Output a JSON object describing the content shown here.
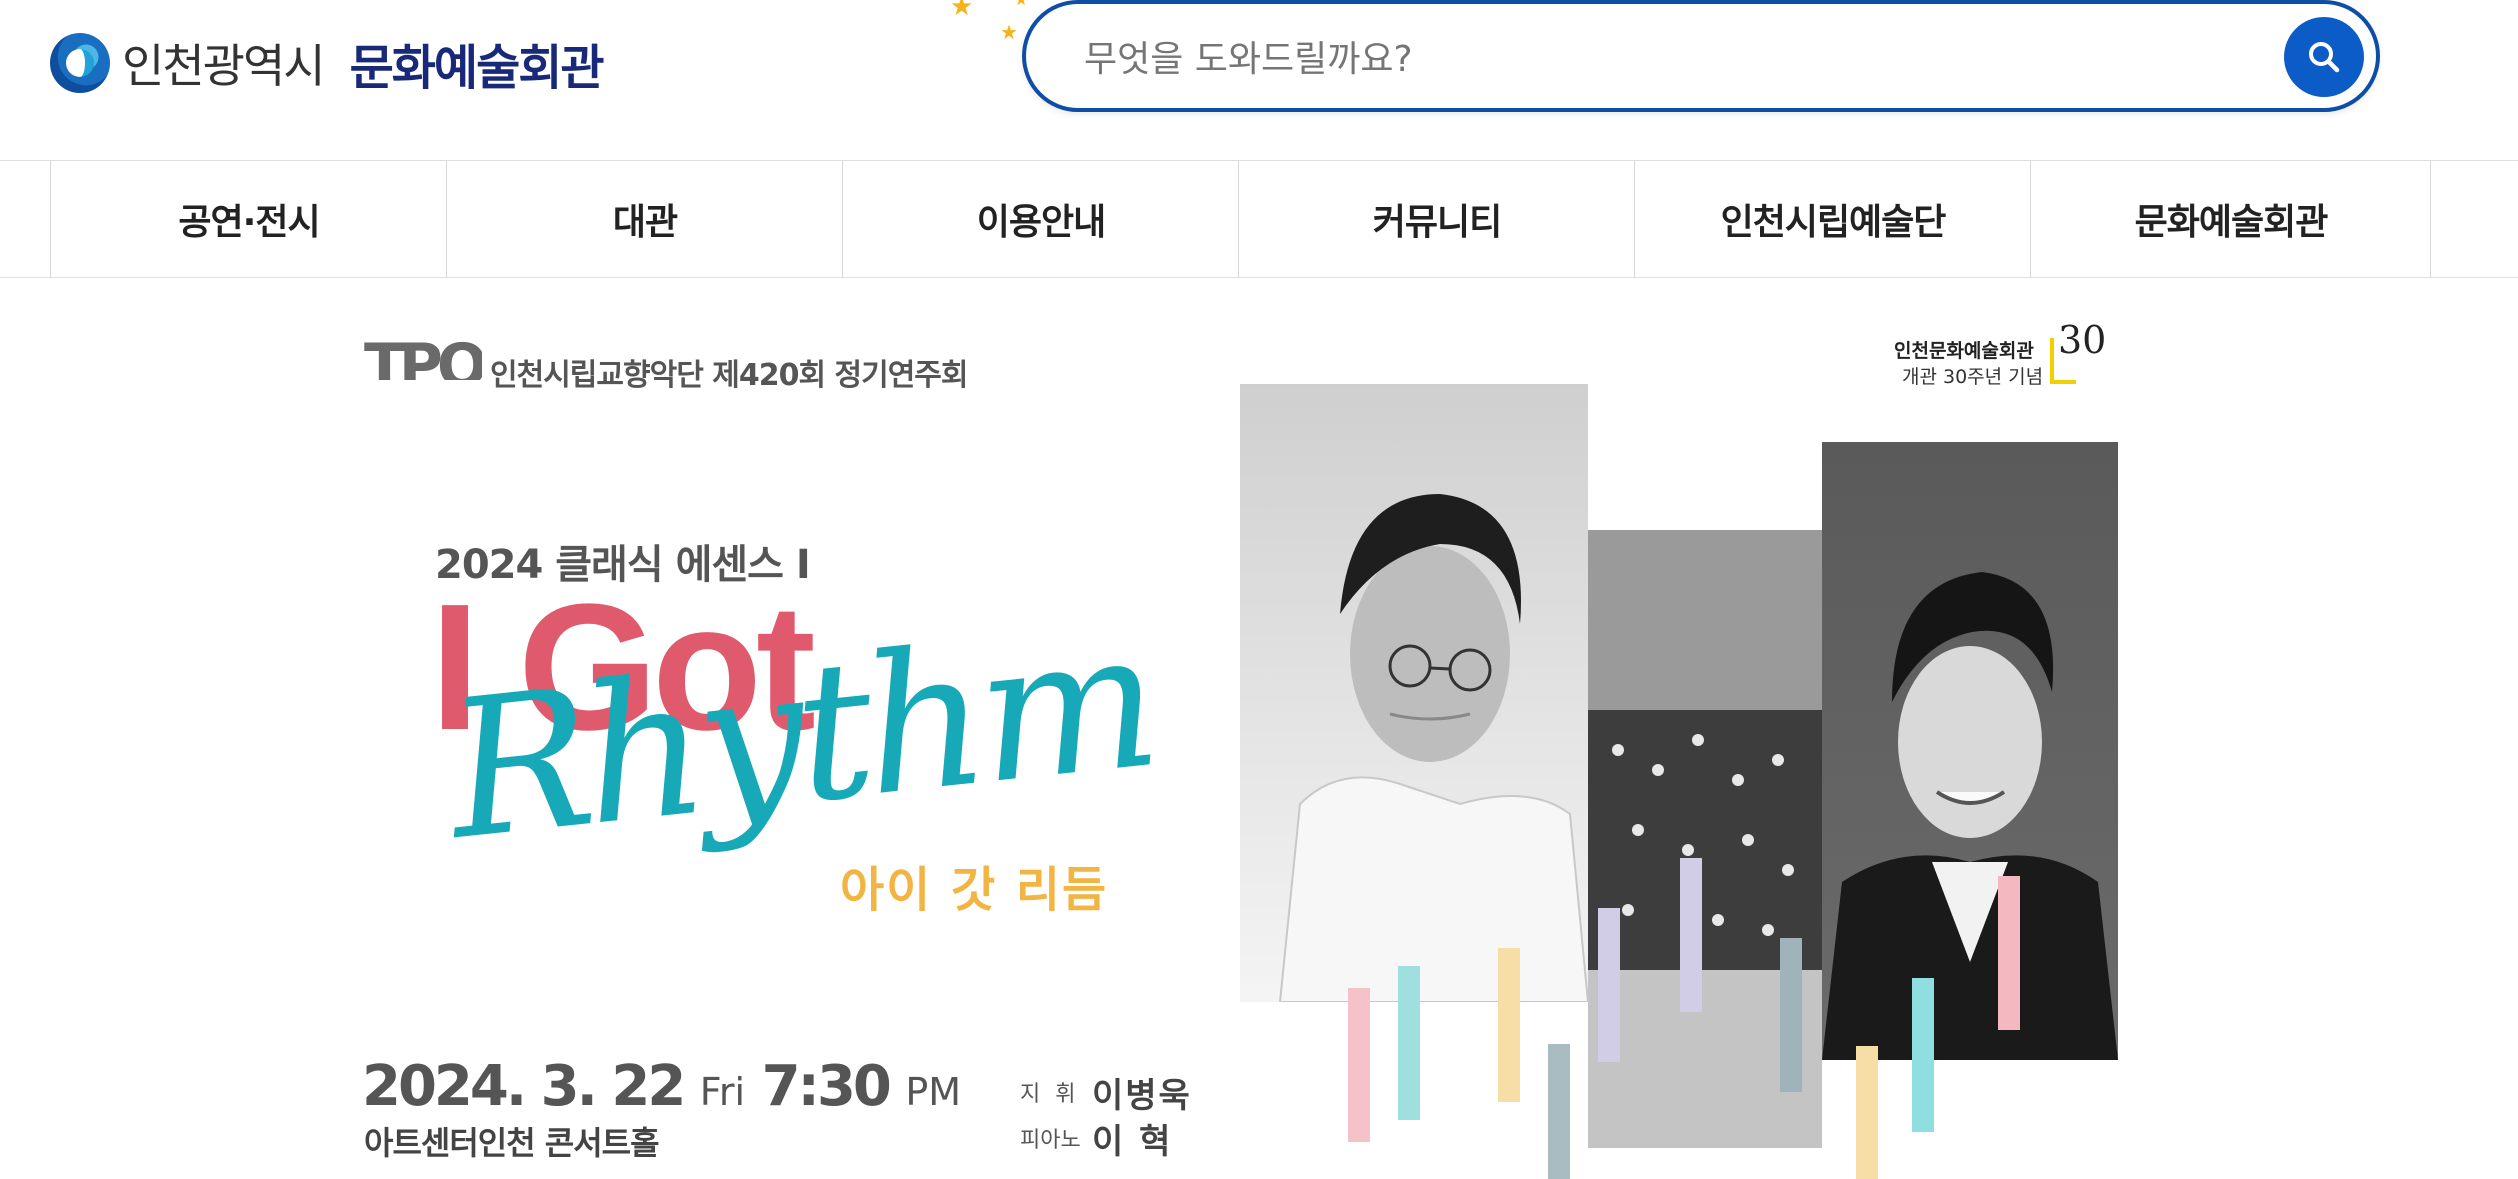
{
  "header": {
    "logo_city": "인천광역시",
    "logo_hall": "문화예술회관",
    "search_placeholder": "무엇을 도와드릴까요?"
  },
  "nav": {
    "items": [
      {
        "label": "공연·전시"
      },
      {
        "label": "대관"
      },
      {
        "label": "이용안내"
      },
      {
        "label": "커뮤니티"
      },
      {
        "label": "인천시립예술단"
      },
      {
        "label": "문화예술회관"
      }
    ]
  },
  "banner": {
    "orchestra_logo": "TPO",
    "concert_series_line": "인천시립교향악단 제420회 정기연주회",
    "anniversary_line1": "인천문화예술회관",
    "anniversary_line2": "개관 30주년 기념",
    "anniversary_number": "30",
    "series_title": "2024 클래식 에센스 Ⅰ",
    "title_line1": "I Got",
    "title_line2": "Rhythm",
    "title_korean": "아이 갓 리듬",
    "date_main": "2024. 3. 22",
    "date_day": "Fri",
    "time_main": "7:30",
    "time_suffix": "PM",
    "venue": "아트센터인천 콘서트홀",
    "credits": [
      {
        "role": "지 휘",
        "name": "이병욱"
      },
      {
        "role": "피아노",
        "name": "이  혁"
      }
    ]
  },
  "colors": {
    "brand_blue": "#0e4ea6",
    "title_pink": "#e05a6d",
    "title_teal": "#17a9b8",
    "title_yellow": "#f2b544"
  }
}
